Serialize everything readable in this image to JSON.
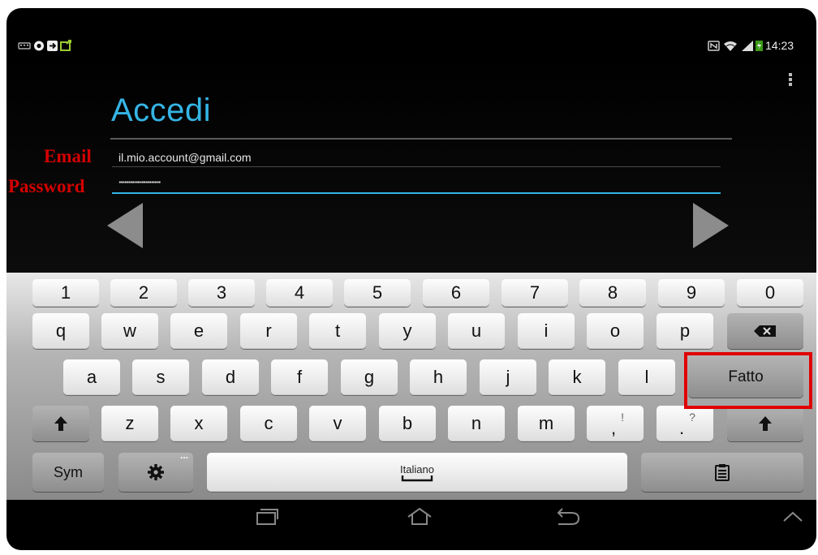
{
  "status": {
    "time": "14:23"
  },
  "app": {
    "title": "Accedi",
    "email_value": "il.mio.account@gmail.com",
    "password_value": "······················"
  },
  "annotations": {
    "email": "Email",
    "password": "Password"
  },
  "keyboard": {
    "numbers": [
      "1",
      "2",
      "3",
      "4",
      "5",
      "6",
      "7",
      "8",
      "9",
      "0"
    ],
    "row1": [
      "q",
      "w",
      "e",
      "r",
      "t",
      "y",
      "u",
      "i",
      "o",
      "p"
    ],
    "row2": [
      "a",
      "s",
      "d",
      "f",
      "g",
      "h",
      "j",
      "k",
      "l"
    ],
    "row3": [
      "z",
      "x",
      "c",
      "v",
      "b",
      "n",
      "m"
    ],
    "done_label": "Fatto",
    "sym_label": "Sym",
    "space_label": "Italiano",
    "dots": "...",
    "comma_key": {
      "main": ",",
      "alt": "!"
    },
    "period_key": {
      "main": ".",
      "alt": "?"
    }
  },
  "colors": {
    "accent": "#35b5e5",
    "annotation": "#d40000",
    "highlight_box": "#e00000"
  }
}
